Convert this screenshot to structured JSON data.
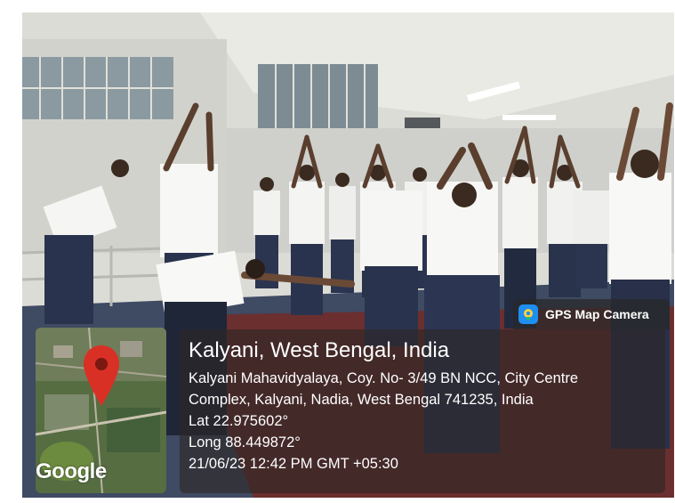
{
  "overlay": {
    "badge_label": "GPS Map Camera",
    "badge_icon": "map-camera-icon",
    "location_title": "Kalyani, West Bengal, India",
    "address_line_1": "Kalyani Mahavidyalaya, Coy. No- 3/49 BN NCC, City Centre",
    "address_line_2": "Complex, Kalyani, Nadia, West Bengal 741235, India",
    "latitude": "Lat 22.975602°",
    "longitude": "Long 88.449872°",
    "timestamp": "21/06/23 12:42 PM GMT +05:30"
  },
  "map": {
    "logo_text": "Google",
    "pin_icon": "location-pin-icon",
    "pin_color": "#d93025"
  },
  "photo": {
    "scene": "group-yoga-session"
  }
}
